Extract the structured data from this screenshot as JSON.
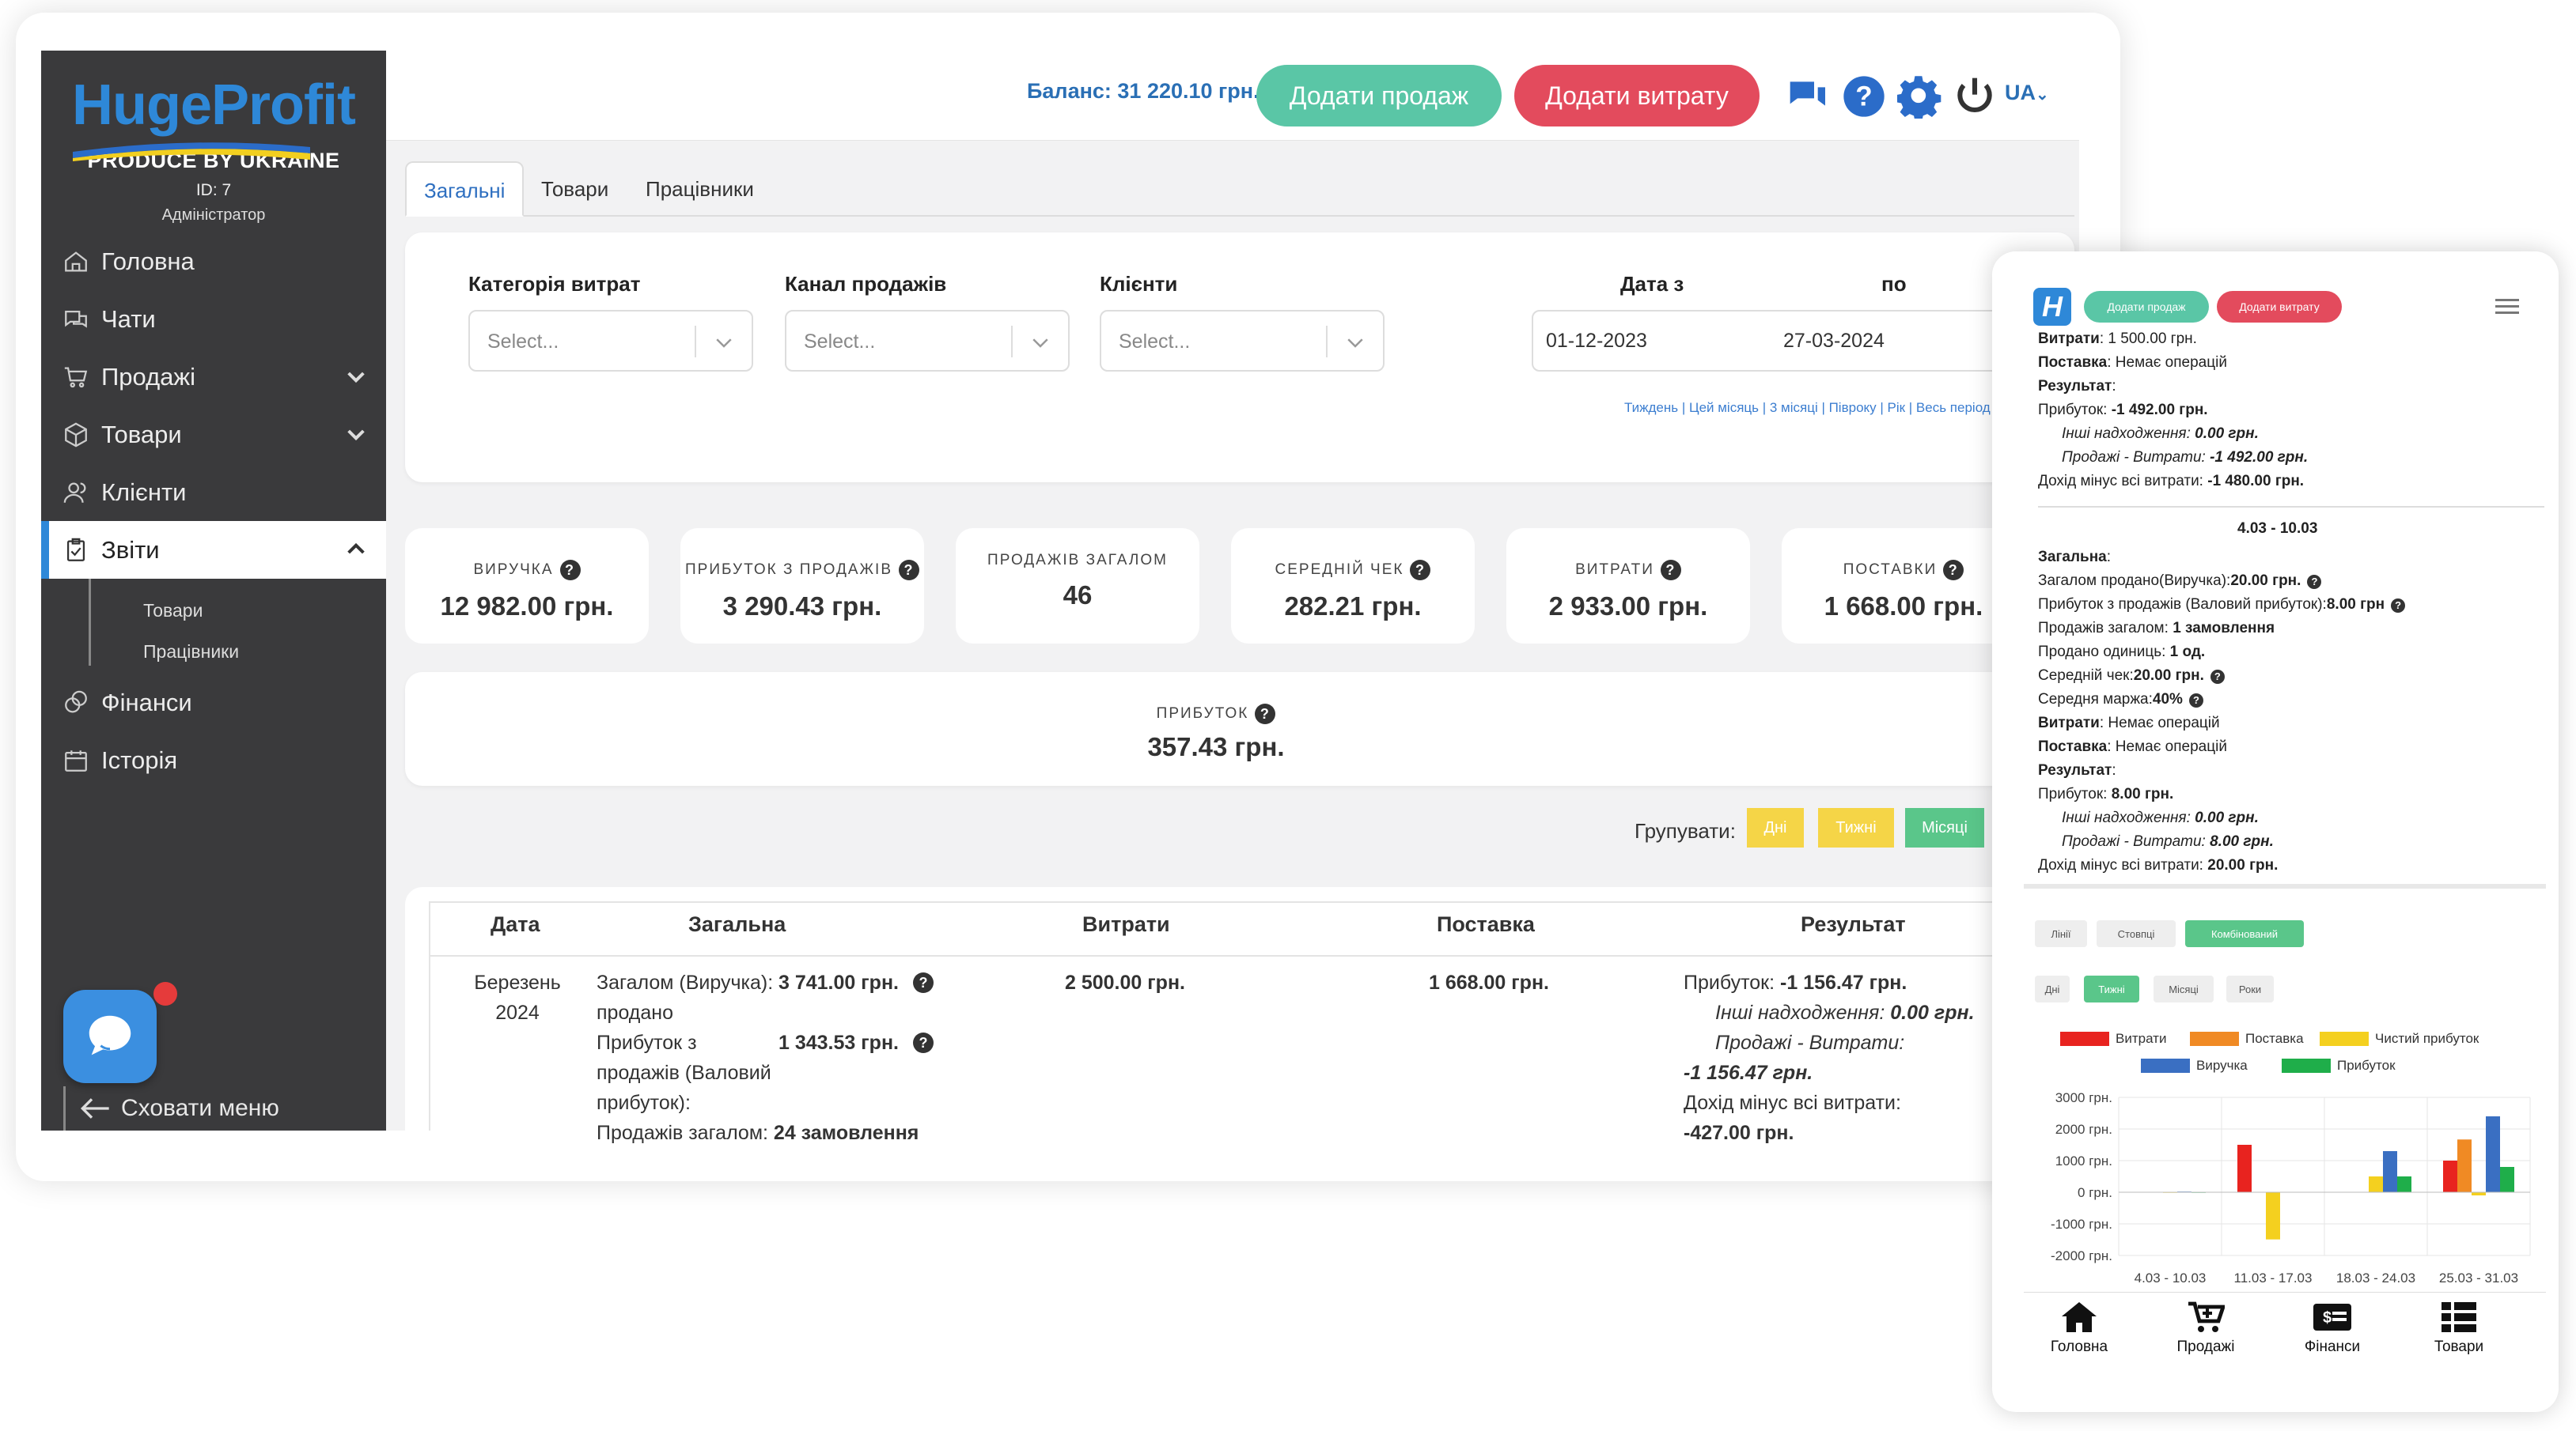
{
  "app": {
    "logo": "HugeProfit",
    "tagline": "PRODUCE BY UKRAINE",
    "user_id": "ID: 7",
    "user_role": "Адміністратор"
  },
  "sidebar": {
    "items": [
      {
        "label": "Головна",
        "icon": "home-icon"
      },
      {
        "label": "Чати",
        "icon": "chat-icon"
      },
      {
        "label": "Продажі",
        "icon": "cart-icon",
        "chevron": "down"
      },
      {
        "label": "Товари",
        "icon": "box-icon",
        "chevron": "down"
      },
      {
        "label": "Клієнти",
        "icon": "users-icon"
      },
      {
        "label": "Звіти",
        "icon": "report-icon",
        "chevron": "up",
        "active": true
      },
      {
        "label": "Фінанси",
        "icon": "coins-icon"
      },
      {
        "label": "Історія",
        "icon": "calendar-icon"
      }
    ],
    "submenu": [
      "Товари",
      "Працівники"
    ],
    "hide_menu": "Сховати меню"
  },
  "topbar": {
    "balance": "Баланс: 31 220.10 грн.",
    "add_sale": "Додати продаж",
    "add_expense": "Додати витрату",
    "lang": "UA"
  },
  "tabs": [
    "Загальні",
    "Товари",
    "Працівники"
  ],
  "filters": {
    "expense_category": {
      "label": "Категорія витрат",
      "placeholder": "Select..."
    },
    "sales_channel": {
      "label": "Канал продажів",
      "placeholder": "Select..."
    },
    "clients": {
      "label": "Клієнти",
      "placeholder": "Select..."
    },
    "date_from_label": "Дата з",
    "date_to_label": "по",
    "date_from": "01-12-2023",
    "date_to": "27-03-2024",
    "quick_ranges": "Тиждень | Цей місяць | 3 місяці | Півроку | Рік | Весь період"
  },
  "stats": [
    {
      "label": "ВИРУЧКА",
      "value": "12 982.00 грн.",
      "help": true
    },
    {
      "label": "ПРИБУТОК З ПРОДАЖІВ",
      "value": "3 290.43 грн.",
      "help": true
    },
    {
      "label": "ПРОДАЖІВ ЗАГАЛОМ",
      "value": "46",
      "help": false
    },
    {
      "label": "СЕРЕДНІЙ ЧЕК",
      "value": "282.21 грн.",
      "help": true
    },
    {
      "label": "ВИТРАТИ",
      "value": "2 933.00 грн.",
      "help": true
    },
    {
      "label": "ПОСТАВКИ",
      "value": "1 668.00 грн.",
      "help": true
    }
  ],
  "profit": {
    "label": "ПРИБУТОК",
    "value": "357.43 грн."
  },
  "grouping": {
    "label": "Групувати:",
    "options": [
      "Дні",
      "Тижні",
      "Місяці"
    ],
    "active": "Місяці",
    "colors": {
      "inactive": "#f5d547",
      "active": "#5ac68a"
    }
  },
  "table": {
    "headers": [
      "Дата",
      "Загальна",
      "Витрати",
      "Поставка",
      "Результат"
    ],
    "row": {
      "date_month": "Березень",
      "date_year": "2024",
      "general_l1": "Загалом  (Виручка):",
      "general_v1": "3 741.00 грн.",
      "general_l1b": "продано",
      "general_l2": "Прибуток з",
      "general_v2": "1 343.53 грн.",
      "general_l2b": "продажів (Валовий",
      "general_l2c": "прибуток):",
      "general_l3": "Продажів загалом:",
      "general_v3": "24 замовлення",
      "expenses": "2 500.00 грн.",
      "supply": "1 668.00 грн.",
      "result_l1": "Прибуток:",
      "result_v1": "-1 156.47 грн.",
      "result_l2": "Інші надходження:",
      "result_v2": "0.00 грн.",
      "result_l3": "Продажі - Витрати:",
      "result_v3": "-1 156.47 грн.",
      "result_l4": "Дохід мінус всі витрати:",
      "result_v4": "-427.00 грн."
    }
  },
  "mobile": {
    "add_sale": "Додати продаж",
    "add_expense": "Додати витрату",
    "lines_top": [
      {
        "b": "Витрати",
        "t": ": 1 500.00 грн."
      },
      {
        "b": "Поставка",
        "t": ": Немає операцій"
      },
      {
        "b": "Результат",
        "t": ":"
      },
      {
        "b": "",
        "t": "Прибуток: ",
        "bv": "-1 492.00 грн."
      },
      {
        "b": "",
        "t": "Інші надходження: ",
        "bv": "0.00 грн.",
        "ind": true
      },
      {
        "b": "",
        "t": "Продажі - Витрати: ",
        "bv": "-1 492.00 грн.",
        "ind": true
      },
      {
        "b": "",
        "t": "Дохід мінус всі витрати: ",
        "bv": "-1 480.00 грн."
      }
    ],
    "period": "4.03 - 10.03",
    "lines_bottom": [
      {
        "b": "Загальна",
        "t": ":"
      },
      {
        "b": "",
        "t": "Загалом продано(Виручка):",
        "bv": "20.00 грн.",
        "help": true
      },
      {
        "b": "",
        "t": "Прибуток з продажів (Валовий прибуток):",
        "bv": "8.00 грн",
        "help": true
      },
      {
        "b": "",
        "t": "Продажів загалом: ",
        "bv": "1 замовлення"
      },
      {
        "b": "",
        "t": "Продано одиниць: ",
        "bv": "1 од."
      },
      {
        "b": "",
        "t": "Середній чек:",
        "bv": "20.00 грн.",
        "help": true
      },
      {
        "b": "",
        "t": "Середня маржа:",
        "bv": "40%",
        "help": true
      },
      {
        "b": "Витрати",
        "t": ": Немає операцій"
      },
      {
        "b": "Поставка",
        "t": ": Немає операцій"
      },
      {
        "b": "Результат",
        "t": ":"
      },
      {
        "b": "",
        "t": "Прибуток: ",
        "bv": "8.00 грн."
      },
      {
        "b": "",
        "t": "Інші надходження: ",
        "bv": "0.00 грн.",
        "ind": true
      },
      {
        "b": "",
        "t": "Продажі - Витрати: ",
        "bv": "8.00 грн.",
        "ind": true
      },
      {
        "b": "",
        "t": "Дохід мінус всі витрати: ",
        "bv": "20.00 грн."
      }
    ],
    "chart_types": [
      "Лінії",
      "Стовпці",
      "Комбінований"
    ],
    "chart_type_active": "Комбінований",
    "chart_periods": [
      "Дні",
      "Тижні",
      "Місяці",
      "Роки"
    ],
    "chart_period_active": "Тижні",
    "bottom_nav": [
      "Головна",
      "Продажі",
      "Фінанси",
      "Товари"
    ]
  },
  "chart_data": {
    "type": "bar",
    "categories": [
      "4.03 - 10.03",
      "11.03 - 17.03",
      "18.03 - 24.03",
      "25.03 - 31.03"
    ],
    "ylim": [
      -2000,
      3000
    ],
    "yticks": [
      "3000 грн.",
      "2000 грн.",
      "1000 грн.",
      "0 грн.",
      "-1000 грн.",
      "-2000 грн."
    ],
    "series": [
      {
        "name": "Витрати",
        "color": "#e8231f",
        "values": [
          0,
          1500,
          0,
          1000
        ]
      },
      {
        "name": "Поставка",
        "color": "#f08a24",
        "values": [
          0,
          0,
          0,
          1668
        ]
      },
      {
        "name": "Чистий прибуток",
        "color": "#f4d01f",
        "values": [
          8,
          -1492,
          500,
          -100
        ]
      },
      {
        "name": "Виручка",
        "color": "#3a6fc2",
        "values": [
          20,
          0,
          1300,
          2400
        ]
      },
      {
        "name": "Прибуток",
        "color": "#1fae4a",
        "values": [
          8,
          0,
          500,
          800
        ]
      }
    ],
    "grid": true
  }
}
